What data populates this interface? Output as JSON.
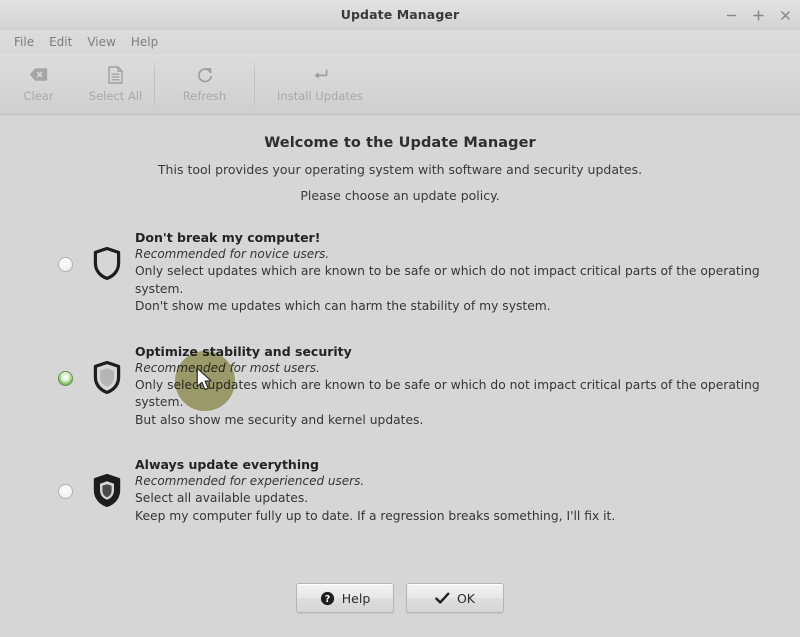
{
  "window": {
    "title": "Update Manager",
    "controls": [
      {
        "name": "minimize",
        "glyph": "−"
      },
      {
        "name": "maximize",
        "glyph": "+"
      },
      {
        "name": "close",
        "glyph": "×"
      }
    ]
  },
  "menubar": {
    "items": [
      {
        "label": "File"
      },
      {
        "label": "Edit"
      },
      {
        "label": "View"
      },
      {
        "label": "Help"
      }
    ]
  },
  "toolbar": {
    "buttons": [
      {
        "label": "Clear",
        "icon": "clear-backspace-icon",
        "enabled": false
      },
      {
        "label": "Select All",
        "icon": "document-icon",
        "enabled": false
      },
      {
        "label": "Refresh",
        "icon": "refresh-circular-arrow-icon",
        "enabled": false
      },
      {
        "label": "Install Updates",
        "icon": "install-enter-arrow-icon",
        "enabled": false
      }
    ]
  },
  "intro": {
    "heading": "Welcome to the Update Manager",
    "line1": "This tool provides your operating system with software and security updates.",
    "line2": "Please choose an update policy."
  },
  "policies": [
    {
      "id": "dont-break-my-computer",
      "title": "Don't break my computer!",
      "recommendation": "Recommended for novice users.",
      "detail1": "Only select updates which are known to be safe or which do not impact critical parts of the operating system.",
      "detail2": "Don't show me updates which can harm the stability of my system.",
      "selected": false,
      "icon": "shield-outline-icon"
    },
    {
      "id": "optimize-stability-and-security",
      "title": "Optimize stability and security",
      "recommendation": "Recommended for most users.",
      "detail1": "Only select updates which are known to be safe or which do not impact critical parts of the operating system.",
      "detail2": "But also show me security and kernel updates.",
      "selected": true,
      "icon": "shield-light-fill-icon"
    },
    {
      "id": "always-update-everything",
      "title": "Always update everything",
      "recommendation": "Recommended for experienced users.",
      "detail1": "Select all available updates.",
      "detail2": "Keep my computer fully up to date. If a regression breaks something, I'll fix it.",
      "selected": false,
      "icon": "shield-dark-fill-icon"
    }
  ],
  "footer": {
    "help_label": "Help",
    "help_icon": "help-question-circle-icon",
    "ok_label": "OK",
    "ok_icon": "checkmark-icon"
  },
  "colors": {
    "window_background": "#d6d6d6",
    "titlebar": "#dcdcdc",
    "selected_radio_green": "#5f9b3f",
    "text_primary": "#2e2e2e",
    "text_disabled": "#a9a9a9",
    "click_highlight": "#8b892e"
  }
}
